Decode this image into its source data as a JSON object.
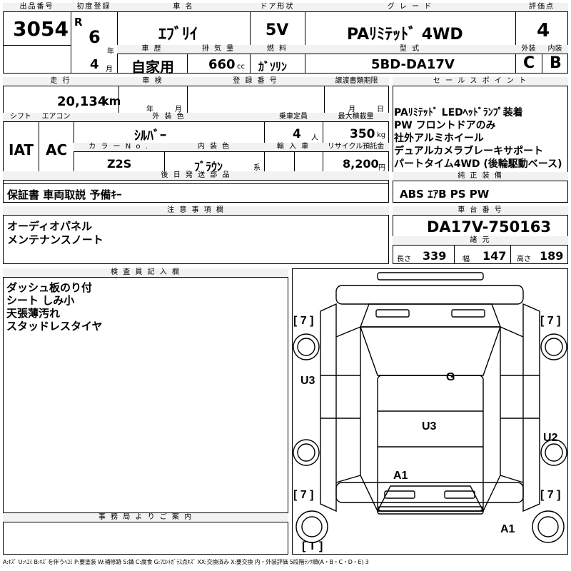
{
  "header": {
    "lot_label": "出品番号",
    "lot_value": "3054",
    "first_reg_label": "初度登録",
    "era": "R",
    "year": "6",
    "year_unit": "年",
    "month": "4",
    "month_unit": "月",
    "car_name_label": "車 名",
    "car_name": "ｴﾌﾞﾘｲ",
    "door_label": "ドア形状",
    "door": "5V",
    "grade_label": "グ レ ー ド",
    "grade": "PAﾘﾐﾃｯﾄﾞ 4WD",
    "score_label": "評価点",
    "score": "4",
    "history_label": "車 歴",
    "history": "自家用",
    "displacement_label": "排 気 量",
    "displacement": "660",
    "displacement_unit": "cc",
    "fuel_label": "燃 料",
    "fuel": "ｶﾞｿﾘﾝ",
    "model_label": "型 式",
    "model": "5BD-DA17V",
    "exterior_label": "外装",
    "exterior": "C",
    "interior_label": "内装",
    "interior": "B"
  },
  "row2": {
    "mileage_label": "走 行",
    "mileage": "20,134",
    "mileage_unit": "km",
    "inspection_label": "車 検",
    "inspection_year": "年",
    "inspection_month": "月",
    "reg_no_label": "登 録 番 号",
    "transfer_label": "譲渡書類期限",
    "transfer_month": "月",
    "transfer_day": "日",
    "shift_label": "シフト",
    "shift": "IAT",
    "ac_label": "エアコン",
    "ac": "AC",
    "color_label": "外 装 色",
    "color": "ｼﾙﾊﾞｰ",
    "capacity_label": "乗車定員",
    "capacity": "4",
    "capacity_unit": "人",
    "load_label": "最大積載量",
    "load": "350",
    "load_unit": "kg",
    "color_no_label": "カ ラ ー N o .",
    "color_no": "Z2S",
    "int_color_label": "内 装 色",
    "int_color": "ﾌﾞﾗｳﾝ",
    "int_color_unit": "系",
    "import_label": "輸 入 車",
    "recycle_label": "リサイクル預託金",
    "recycle": "8,200",
    "recycle_unit": "円"
  },
  "sales": {
    "label": "セ ー ル ス ポ イ ン ト",
    "lines": [
      "PAﾘﾐﾃｯﾄﾞ LEDﾍｯﾄﾞﾗﾝﾌﾟ装着",
      "PW フロントドアのみ",
      "社外アルミホイール",
      "デュアルカメラブレーキサポート",
      "パートタイム4WD (後輪駆動ベース)"
    ]
  },
  "later": {
    "label": "後 日 発 送 部 品",
    "text": "保証書 車両取説 予備ｷｰ"
  },
  "equipment": {
    "label": "純 正 装 備",
    "text": "ABS ｴｱB PS PW"
  },
  "caution": {
    "label": "注 意 事 項 欄",
    "lines": [
      "オーディオパネル",
      "メンテナンスノート"
    ]
  },
  "chassis": {
    "label": "車 台 番 号",
    "value": "DA17V-750163"
  },
  "spec": {
    "label": "諸 元",
    "length_label": "長さ",
    "length": "339",
    "width_label": "幅",
    "width": "147",
    "height_label": "高さ",
    "height": "189"
  },
  "inspector": {
    "label": "検 査 員 記 入 欄",
    "lines": [
      "ダッシュ板のり付",
      "シート しみ小",
      "天張薄汚れ",
      "スタッドレスタイヤ"
    ]
  },
  "office": {
    "label": "事 務 局 よ り ご 案 内"
  },
  "diagram": {
    "marks": {
      "tire_fl": "[ 7 ]",
      "tire_fr": "[ 7 ]",
      "tire_rl": "[ 7 ]",
      "tire_rr": "[ 7 ]",
      "spare": "[ T ]",
      "left_side": "U3",
      "roof": "G",
      "roof_mid": "U3",
      "right_side": "U2",
      "back_door": "A1",
      "rear_bumper": "A1"
    }
  },
  "legend": "A:ｷｽﾞ U:ﾍｺﾐ B:ｷｽﾞを伴うﾍｺﾐ P:要塗装 W:補修跡 S:錆 C:腐食 G:ﾌﾛﾝﾄｶﾞﾗｽ点ｷｽﾞ XX:交換済み X:要交換 内・外装評価 5段階ﾗﾝｸ順(A・B・C・D・E) 3"
}
